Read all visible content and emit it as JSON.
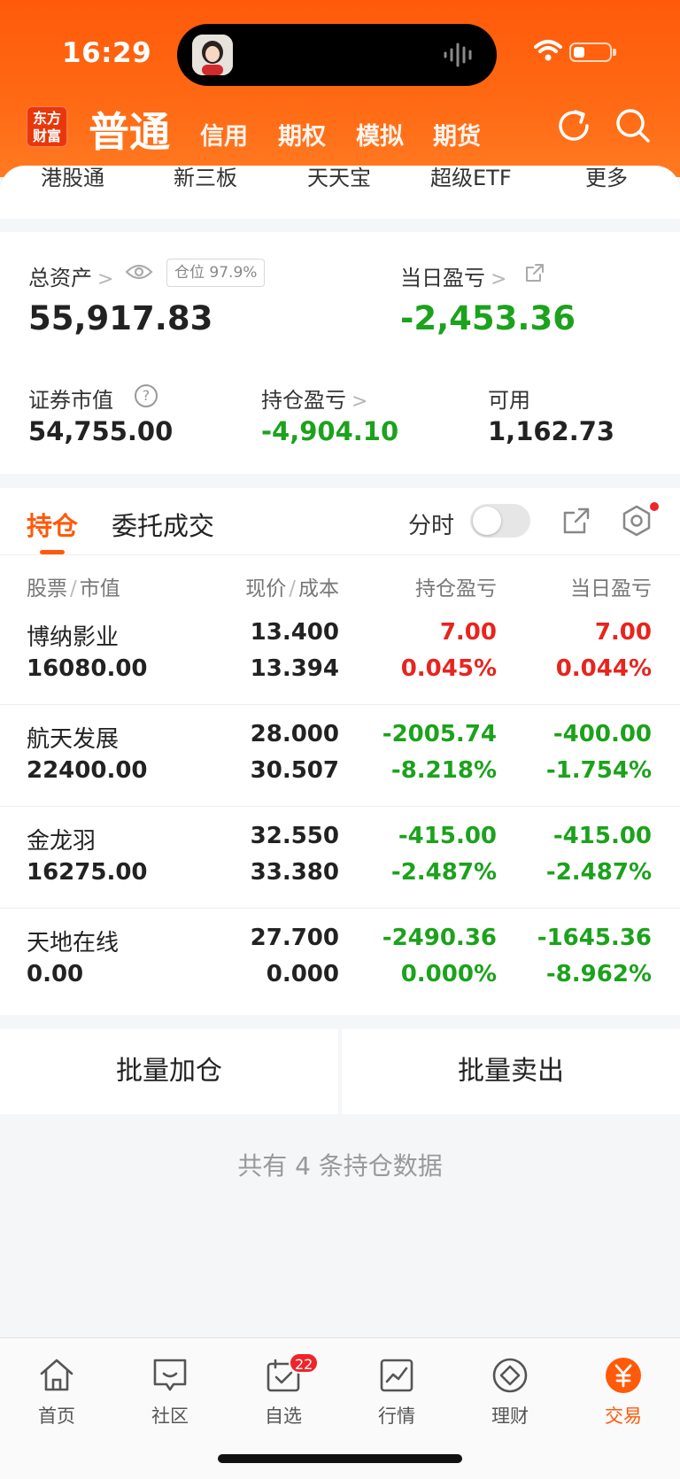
{
  "status_bar": {
    "time": "16:29"
  },
  "header": {
    "logo_line1": "东方",
    "logo_line2": "财富",
    "tabs": [
      "普通",
      "信用",
      "期权",
      "模拟",
      "期货"
    ]
  },
  "quick_menu": [
    "港股通",
    "新三板",
    "天天宝",
    "超级ETF",
    "更多"
  ],
  "assets": {
    "total_label": "总资产",
    "total_value": "55,917.83",
    "position_ratio": "仓位 97.9%",
    "daily_pl_label": "当日盈亏",
    "daily_pl_value": "-2,453.36",
    "market_value_label": "证券市值",
    "market_value": "54,755.00",
    "holding_pl_label": "持仓盈亏",
    "holding_pl_value": "-4,904.10",
    "available_label": "可用",
    "available_value": "1,162.73"
  },
  "holdings_tabs": {
    "active": "持仓",
    "other": "委托成交",
    "fenshi": "分时"
  },
  "columns": {
    "c1a": "股票",
    "c1b": "市值",
    "c2a": "现价",
    "c2b": "成本",
    "c3": "持仓盈亏",
    "c4": "当日盈亏"
  },
  "rows": [
    {
      "name": "博纳影业",
      "market_value": "16080.00",
      "price": "13.400",
      "cost": "13.394",
      "pl": "7.00",
      "pl_pct": "0.045%",
      "day_pl": "7.00",
      "day_pl_pct": "0.044%",
      "pl_color": "red",
      "day_color": "red"
    },
    {
      "name": "航天发展",
      "market_value": "22400.00",
      "price": "28.000",
      "cost": "30.507",
      "pl": "-2005.74",
      "pl_pct": "-8.218%",
      "day_pl": "-400.00",
      "day_pl_pct": "-1.754%",
      "pl_color": "green",
      "day_color": "green"
    },
    {
      "name": "金龙羽",
      "market_value": "16275.00",
      "price": "32.550",
      "cost": "33.380",
      "pl": "-415.00",
      "pl_pct": "-2.487%",
      "day_pl": "-415.00",
      "day_pl_pct": "-2.487%",
      "pl_color": "green",
      "day_color": "green"
    },
    {
      "name": "天地在线",
      "market_value": "0.00",
      "price": "27.700",
      "cost": "0.000",
      "pl": "-2490.36",
      "pl_pct": "0.000%",
      "day_pl": "-1645.36",
      "day_pl_pct": "-8.962%",
      "pl_color": "green",
      "day_color": "green"
    }
  ],
  "batch": {
    "add": "批量加仓",
    "sell": "批量卖出"
  },
  "summary": "共有 4 条持仓数据",
  "bottom_nav": [
    {
      "label": "首页",
      "icon": "home-icon"
    },
    {
      "label": "社区",
      "icon": "community-icon"
    },
    {
      "label": "自选",
      "icon": "watchlist-icon",
      "badge": "22"
    },
    {
      "label": "行情",
      "icon": "market-icon"
    },
    {
      "label": "理财",
      "icon": "wealth-icon"
    },
    {
      "label": "交易",
      "icon": "trade-icon"
    }
  ],
  "colors": {
    "brand": "#ff5a0a",
    "gain": "#e8241e",
    "loss": "#1ca21c"
  }
}
